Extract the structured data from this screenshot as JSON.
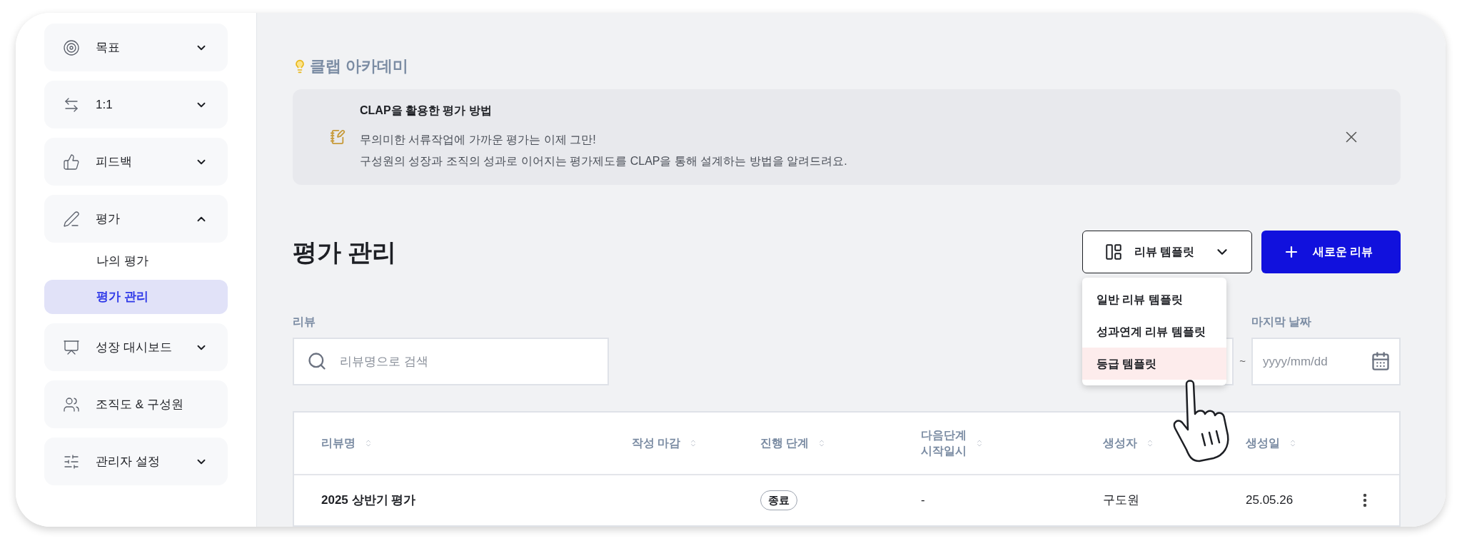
{
  "sidebar": {
    "items": [
      {
        "label": "목표",
        "expanded": false
      },
      {
        "label": "1:1",
        "expanded": false
      },
      {
        "label": "피드백",
        "expanded": false
      },
      {
        "label": "평가",
        "expanded": true,
        "children": [
          {
            "label": "나의 평가",
            "selected": false
          },
          {
            "label": "평가 관리",
            "selected": true
          }
        ]
      },
      {
        "label": "성장 대시보드",
        "expanded": false
      },
      {
        "label": "조직도 & 구성원"
      },
      {
        "label": "관리자 설정",
        "expanded": false
      }
    ]
  },
  "academy": {
    "title": "클랩 아카데미",
    "banner": {
      "title": "CLAP을 활용한 평가 방법",
      "lines": [
        "무의미한 서류작업에 가까운 평가는 이제 그만!",
        "구성원의 성장과 조직의 성과로 이어지는 평가제도를 CLAP을 통해 설계하는 방법을 알려드려요."
      ]
    }
  },
  "page_title": "평가 관리",
  "template_button": {
    "label": "리뷰 템플릿",
    "expanded": true
  },
  "new_button": {
    "label": "새로운 리뷰"
  },
  "template_menu": [
    {
      "label": "일반 리뷰 템플릿",
      "highlighted": false
    },
    {
      "label": "성과연계 리뷰 템플릿",
      "highlighted": false
    },
    {
      "label": "등급 템플릿",
      "highlighted": true
    }
  ],
  "filters": {
    "search_label": "리뷰",
    "search_placeholder": "리뷰명으로 검색",
    "separator": "~",
    "end_label": "마지막 날짜",
    "end_placeholder": "yyyy/mm/dd"
  },
  "table": {
    "columns": [
      "리뷰명",
      "작성 마감",
      "진행 단계",
      "다음단계\n시작일시",
      "생성자",
      "생성일"
    ],
    "rows": [
      {
        "name": "2025 상반기 평가",
        "stage": "종료",
        "next_start": "-",
        "creator": "구도원",
        "created": "25.05.26"
      }
    ]
  }
}
